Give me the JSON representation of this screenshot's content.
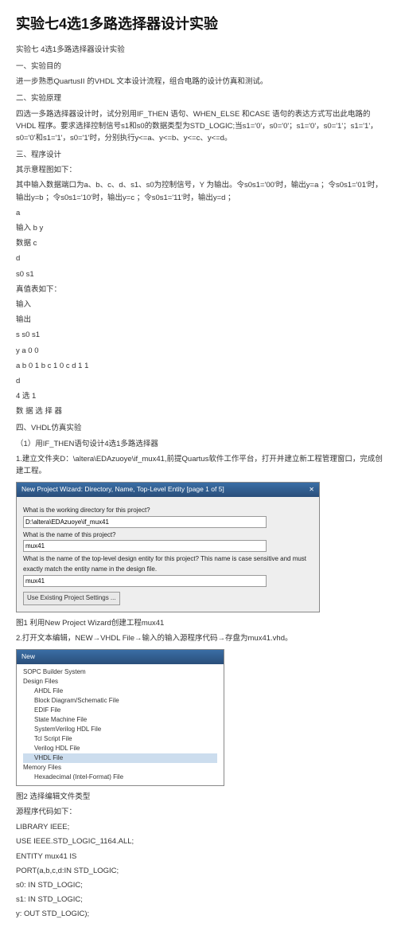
{
  "title": "实验七4选1多路选择器设计实验",
  "lines": {
    "l1": "实验七 4选1多路选择器设计实验",
    "l2": "一、实验目的",
    "l3": "进一步熟悉QuartusII 的VHDL 文本设计流程，组合电路的设计仿真和测试。",
    "l4": "二、实验原理",
    "l5": "四选一多路选择器设计时，试分别用IF_THEN 语句、WHEN_ELSE 和CASE 语句的表达方式写出此电路的VHDL 程序。要求选择控制信号s1和s0的数据类型为STD_LOGIC;当s1='0'，s0='0'；s1='0'，s0='1'；s1='1'，s0='0'和s1='1'，s0='1'时，分别执行y<=a、y<=b、y<=c、y<=d。",
    "l6": "三、程序设计",
    "l7": "其示意程图如下：",
    "l8": "其中输入数据端口为a、b、c、d、s1、s0为控制信号，Y 为输出。令s0s1='00'时，输出y=a ；令s0s1='01'时，输出y=b ；令s0s1='10'时，输出y=c ；令s0s1='11'时，输出y=d ；",
    "r1": "a",
    "r2": "输入 b y",
    "r3": "数据 c",
    "r4": "d",
    "r5": "s0 s1",
    "r6": "真值表如下：",
    "r7": "输入",
    "r8": "输出",
    "r9": "s s0 s1",
    "r10": "y a 0 0",
    "r11": "a b 0 1 b c 1 0 c d 1 1",
    "r12": "d",
    "r13": "4 选 1",
    "r14": "数 据 选 择 器",
    "l9": "四、VHDL仿真实验",
    "l10": "（1）用IF_THEN语句设计4选1多路选择器",
    "l11": "1.建立文件夹D：\\altera\\EDAzuoye\\if_mux41,前提Quartus软件工作平台，打开并建立新工程管理窗口，完成创建工程。",
    "wizard": {
      "title": "New Project Wizard: Directory, Name, Top-Level Entity [page 1 of 5]",
      "q1": "What is the working directory for this project?",
      "v1": "D:\\altera\\EDAzuoye\\if_mux41",
      "q2": "What is the name of this project?",
      "v2": "mux41",
      "q3": "What is the name of the top-level design entity for this project? This name is case sensitive and must exactly match the entity name in the design file.",
      "v3": "mux41",
      "btn": "Use Existing Project Settings ..."
    },
    "cap1": "图1 利用New Project Wizard创建工程mux41",
    "l12": "2.打开文本编辑，NEW→VHDL File→输入的输入源程序代码→存盘为mux41.vhd。",
    "newfile": {
      "title": "New",
      "cat1": "SOPC Builder System",
      "cat2": "Design Files",
      "i1": "AHDL File",
      "i2": "Block Diagram/Schematic File",
      "i3": "EDIF File",
      "i4": "State Machine File",
      "i5": "SystemVerilog HDL File",
      "i6": "Tcl Script File",
      "i7": "Verilog HDL File",
      "i8": "VHDL File",
      "cat3": "Memory Files",
      "i9": "Hexadecimal (Intel-Format) File"
    },
    "cap2": "图2 选择编辑文件类型",
    "l13": "源程序代码如下：",
    "code1": "LIBRARY IEEE;",
    "code2": "USE IEEE.STD_LOGIC_1164.ALL;",
    "code3": "ENTITY mux41 IS",
    "code4": "PORT(a,b,c,d:IN STD_LOGIC;",
    "code5": "s0: IN STD_LOGIC;",
    "code6": "s1: IN STD_LOGIC;",
    "code7": "y: OUT STD_LOGIC);"
  }
}
